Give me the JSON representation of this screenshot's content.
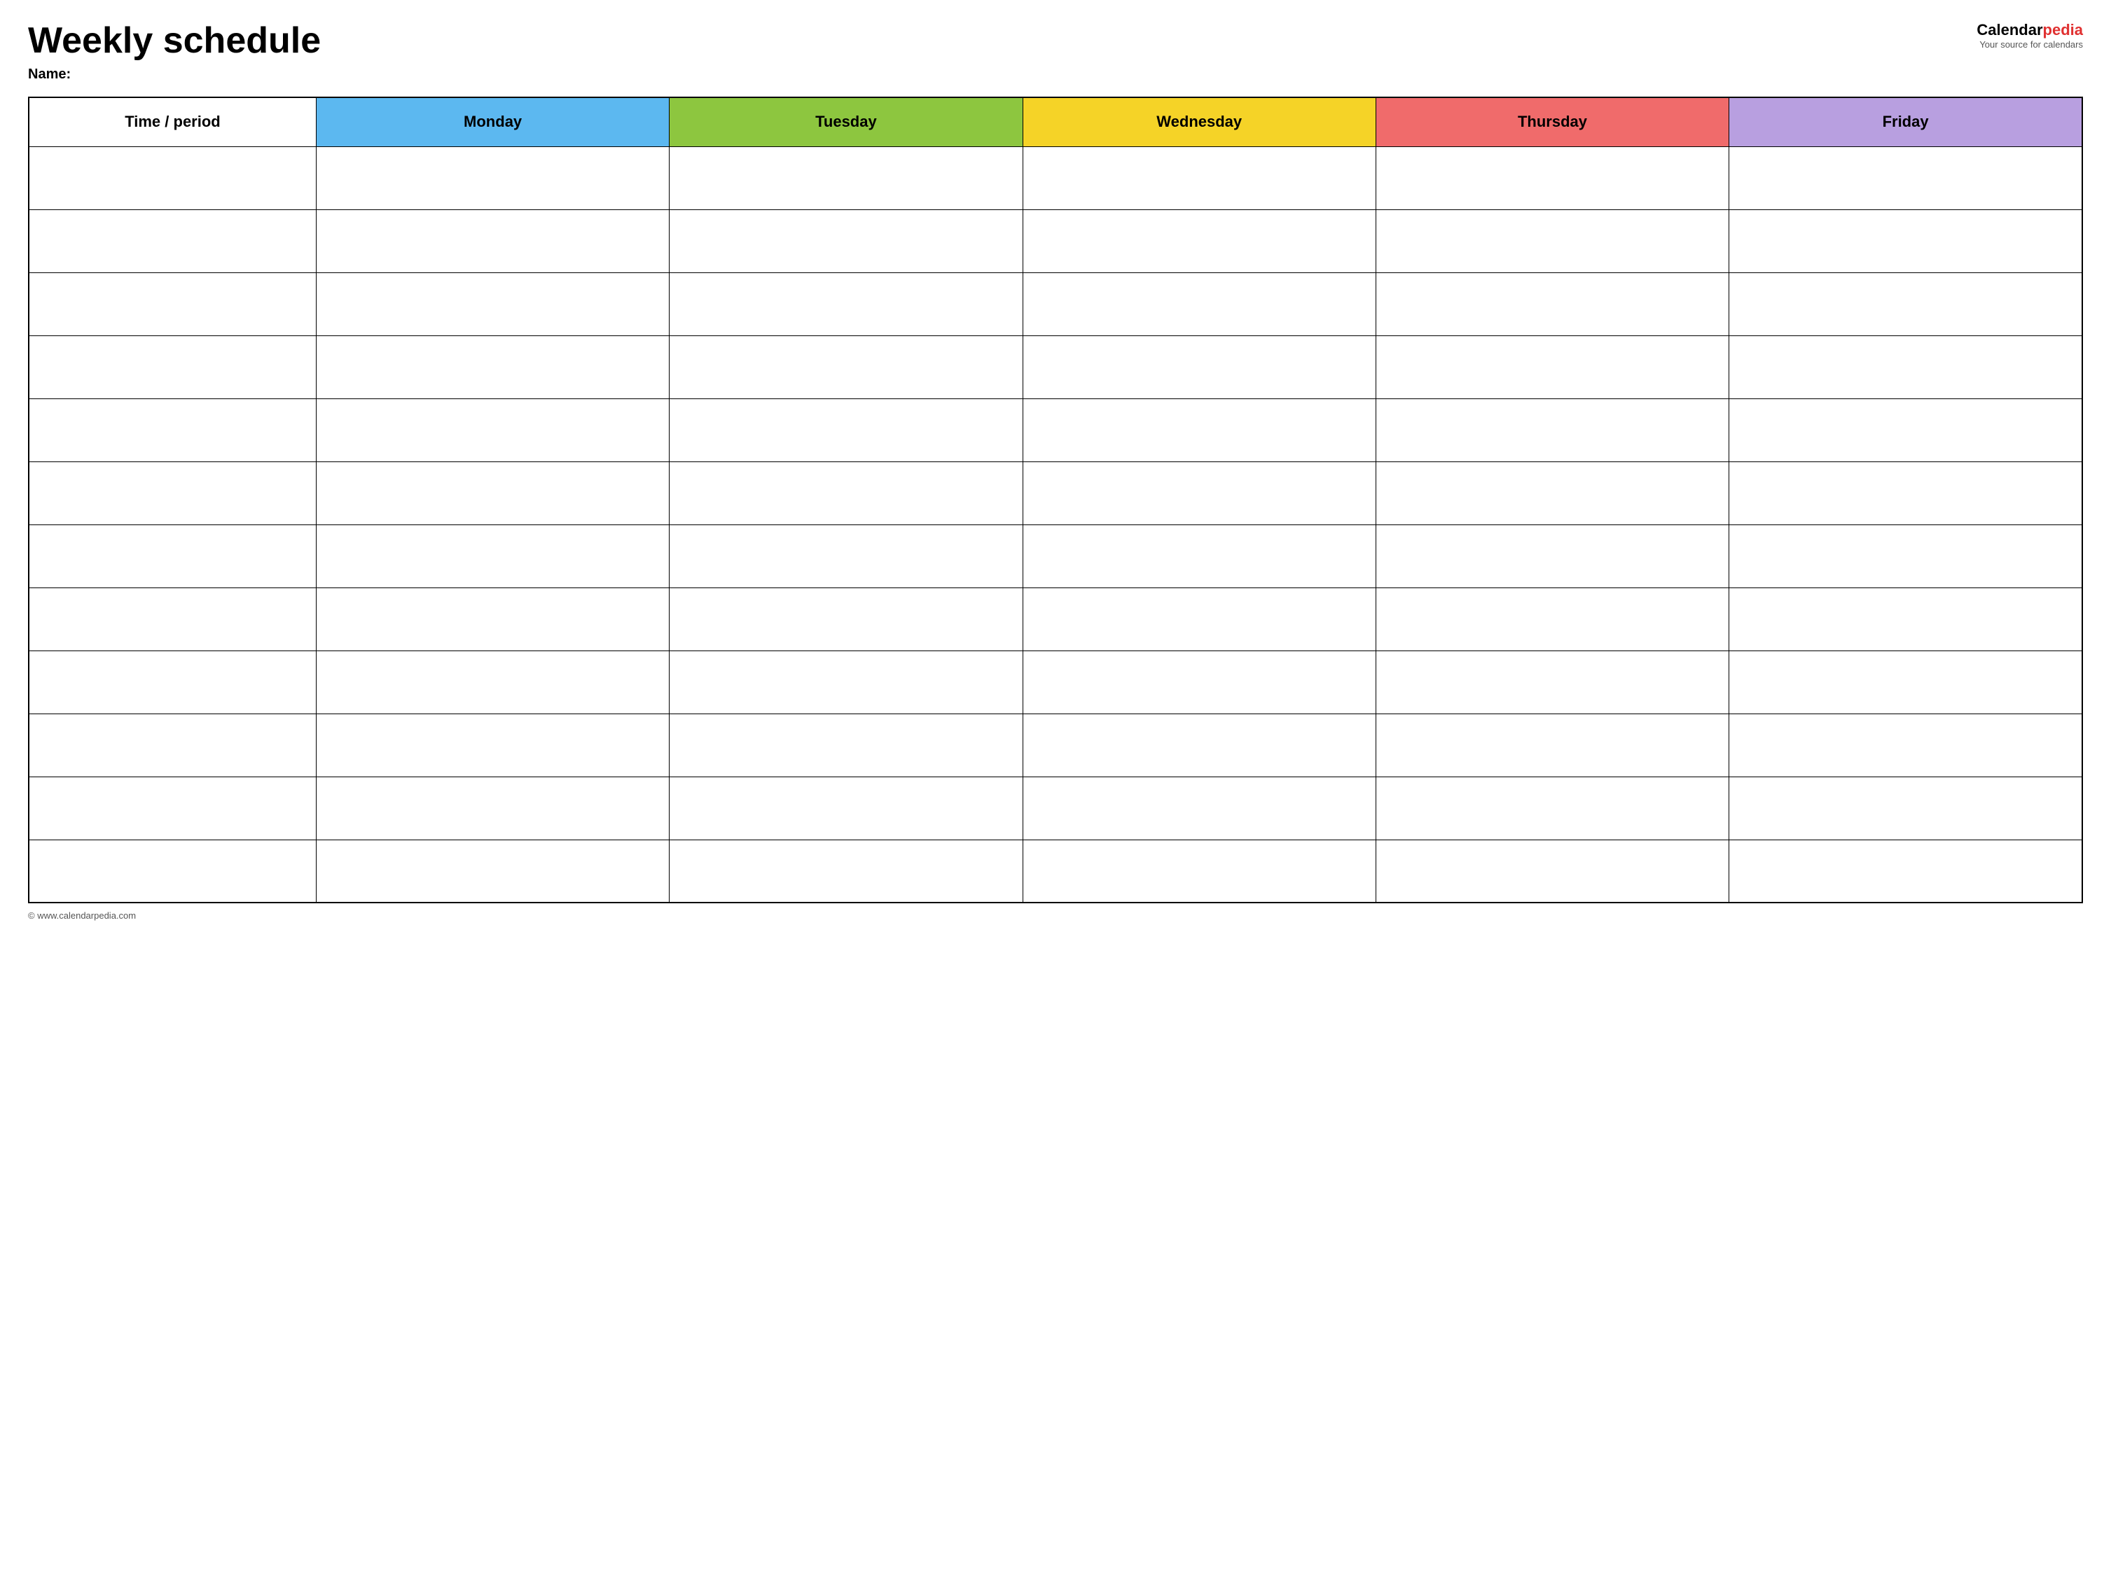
{
  "header": {
    "title": "Weekly schedule",
    "name_label": "Name:",
    "logo_main": "Calendar",
    "logo_accent": "pedia",
    "logo_subtitle": "Your source for calendars"
  },
  "table": {
    "columns": [
      {
        "id": "time",
        "label": "Time / period",
        "color": "#ffffff",
        "text_color": "#000000"
      },
      {
        "id": "monday",
        "label": "Monday",
        "color": "#5cb8f0",
        "text_color": "#000000"
      },
      {
        "id": "tuesday",
        "label": "Tuesday",
        "color": "#8dc63f",
        "text_color": "#000000"
      },
      {
        "id": "wednesday",
        "label": "Wednesday",
        "color": "#f5d327",
        "text_color": "#000000"
      },
      {
        "id": "thursday",
        "label": "Thursday",
        "color": "#f06b6b",
        "text_color": "#000000"
      },
      {
        "id": "friday",
        "label": "Friday",
        "color": "#b89fe0",
        "text_color": "#000000"
      }
    ],
    "row_count": 12
  },
  "footer": {
    "copyright": "© www.calendarpedia.com"
  }
}
